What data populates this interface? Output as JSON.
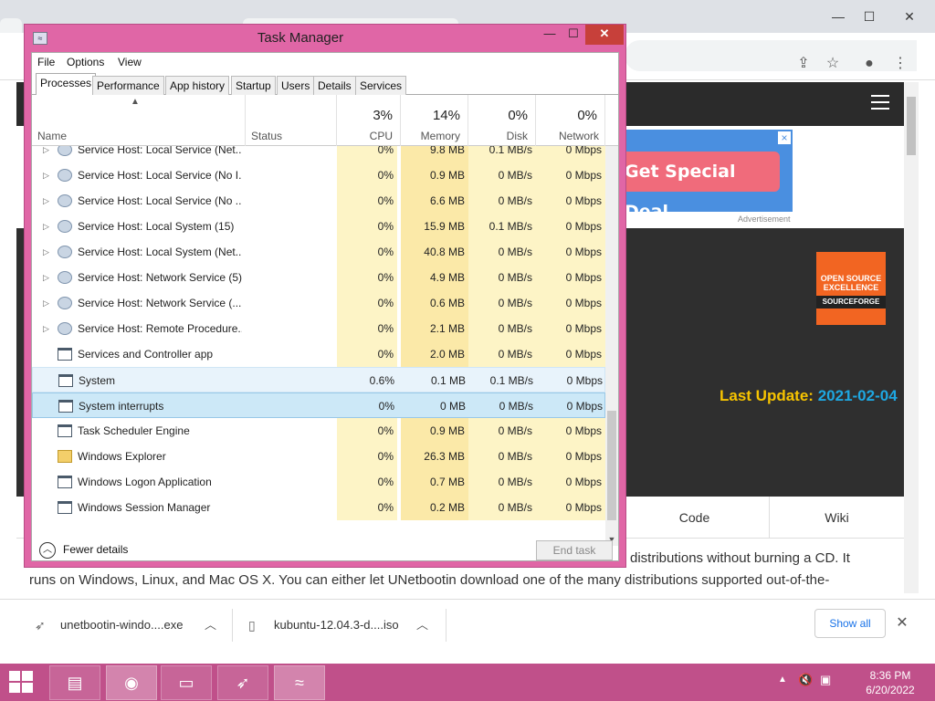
{
  "browser": {
    "controls": {
      "minimize": "—",
      "maximize": "☐",
      "close": "✕"
    },
    "ad": {
      "cta": "Get Special Deal",
      "close": "×",
      "label": "Advertisement"
    },
    "badge": {
      "line1": "OPEN SOURCE",
      "line2": "EXCELLENCE",
      "line3": "SOURCEFORGE"
    },
    "last_update": {
      "label": "Last Update:",
      "date": "2021-02-04"
    },
    "site_tabs": {
      "code": "Code",
      "wiki": "Wiki"
    },
    "article": {
      "line1": "distributions without burning a CD. It",
      "line2": "runs on Windows, Linux, and Mac OS X. You can either let UNetbootin download one of the many distributions supported out-of-the-"
    },
    "downloads": [
      {
        "name": "unetbootin-windo....exe",
        "icon": "rocket-icon"
      },
      {
        "name": "kubuntu-12.04.3-d....iso",
        "icon": "file-icon"
      }
    ],
    "show_all": "Show all"
  },
  "taskmgr": {
    "title": "Task Manager",
    "menu": [
      "File",
      "Options",
      "View"
    ],
    "tabs": [
      "Processes",
      "Performance",
      "App history",
      "Startup",
      "Users",
      "Details",
      "Services"
    ],
    "active_tab": "Processes",
    "columns": {
      "name": "Name",
      "status": "Status",
      "cpu": {
        "pct": "3%",
        "label": "CPU"
      },
      "memory": {
        "pct": "14%",
        "label": "Memory"
      },
      "disk": {
        "pct": "0%",
        "label": "Disk"
      },
      "network": {
        "pct": "0%",
        "label": "Network"
      }
    },
    "rows": [
      {
        "name": "Service Host: Local Service (Net...",
        "cpu": "0%",
        "mem": "9.8 MB",
        "disk": "0.1 MB/s",
        "net": "0 Mbps",
        "icon": "gear",
        "expand": true
      },
      {
        "name": "Service Host: Local Service (No I...",
        "cpu": "0%",
        "mem": "0.9 MB",
        "disk": "0 MB/s",
        "net": "0 Mbps",
        "icon": "gear",
        "expand": true
      },
      {
        "name": "Service Host: Local Service (No ...",
        "cpu": "0%",
        "mem": "6.6 MB",
        "disk": "0 MB/s",
        "net": "0 Mbps",
        "icon": "gear",
        "expand": true
      },
      {
        "name": "Service Host: Local System (15)",
        "cpu": "0%",
        "mem": "15.9 MB",
        "disk": "0.1 MB/s",
        "net": "0 Mbps",
        "icon": "gear",
        "expand": true
      },
      {
        "name": "Service Host: Local System (Net...",
        "cpu": "0%",
        "mem": "40.8 MB",
        "disk": "0 MB/s",
        "net": "0 Mbps",
        "icon": "gear",
        "expand": true
      },
      {
        "name": "Service Host: Network Service (5)",
        "cpu": "0%",
        "mem": "4.9 MB",
        "disk": "0 MB/s",
        "net": "0 Mbps",
        "icon": "gear",
        "expand": true
      },
      {
        "name": "Service Host: Network Service (...",
        "cpu": "0%",
        "mem": "0.6 MB",
        "disk": "0 MB/s",
        "net": "0 Mbps",
        "icon": "gear",
        "expand": true
      },
      {
        "name": "Service Host: Remote Procedure...",
        "cpu": "0%",
        "mem": "2.1 MB",
        "disk": "0 MB/s",
        "net": "0 Mbps",
        "icon": "gear",
        "expand": true
      },
      {
        "name": "Services and Controller app",
        "cpu": "0%",
        "mem": "2.0 MB",
        "disk": "0 MB/s",
        "net": "0 Mbps",
        "icon": "app",
        "expand": false
      },
      {
        "name": "System",
        "cpu": "0.6%",
        "mem": "0.1 MB",
        "disk": "0.1 MB/s",
        "net": "0 Mbps",
        "icon": "app",
        "expand": false,
        "state": "hover"
      },
      {
        "name": "System interrupts",
        "cpu": "0%",
        "mem": "0 MB",
        "disk": "0 MB/s",
        "net": "0 Mbps",
        "icon": "app",
        "expand": false,
        "state": "selected"
      },
      {
        "name": "Task Scheduler Engine",
        "cpu": "0%",
        "mem": "0.9 MB",
        "disk": "0 MB/s",
        "net": "0 Mbps",
        "icon": "app",
        "expand": false
      },
      {
        "name": "Windows Explorer",
        "cpu": "0%",
        "mem": "26.3 MB",
        "disk": "0 MB/s",
        "net": "0 Mbps",
        "icon": "folder",
        "expand": false
      },
      {
        "name": "Windows Logon Application",
        "cpu": "0%",
        "mem": "0.7 MB",
        "disk": "0 MB/s",
        "net": "0 Mbps",
        "icon": "app",
        "expand": false
      },
      {
        "name": "Windows Session Manager",
        "cpu": "0%",
        "mem": "0.2 MB",
        "disk": "0 MB/s",
        "net": "0 Mbps",
        "icon": "app",
        "expand": false
      }
    ],
    "footer": {
      "fewer_details": "Fewer details",
      "end_task": "End task"
    }
  },
  "taskbar": {
    "apps": [
      "file-explorer-icon",
      "chrome-icon",
      "usb-drive-icon",
      "unetbootin-icon",
      "task-manager-icon"
    ],
    "time": "8:36 PM",
    "date": "6/20/2022"
  }
}
